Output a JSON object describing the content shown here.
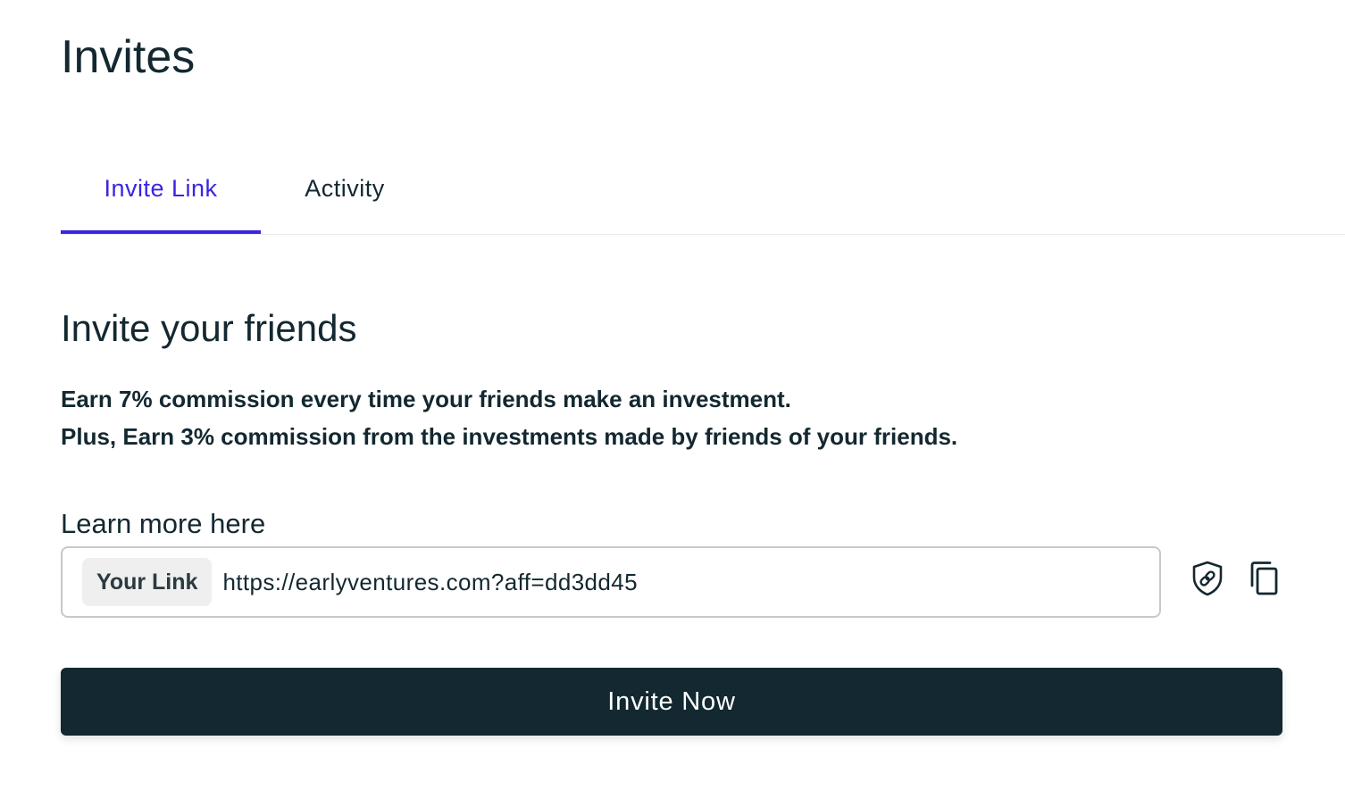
{
  "header": {
    "title": "Invites"
  },
  "tabs": [
    {
      "label": "Invite Link",
      "active": true
    },
    {
      "label": "Activity",
      "active": false
    }
  ],
  "main": {
    "section_title": "Invite your friends",
    "description_lines": [
      "Earn 7% commission every time your friends make an investment.",
      "Plus, Earn 3% commission from the investments made by friends of your friends."
    ],
    "learn_more": "Learn more here",
    "link_field": {
      "tag": "Your Link",
      "value": "https://earlyventures.com?aff=dd3dd45"
    },
    "icons": {
      "shield": "shield-link-icon",
      "copy": "copy-icon"
    },
    "invite_button": "Invite Now"
  },
  "colors": {
    "accent": "#3b25e0",
    "text": "#132830",
    "button_bg": "#132830"
  }
}
